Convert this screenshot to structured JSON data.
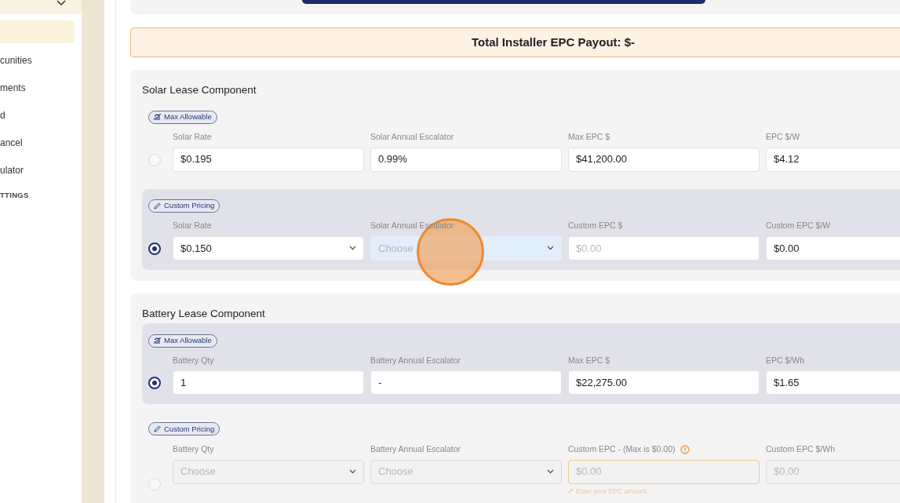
{
  "sidebar": {
    "items": [
      {
        "selected": true
      },
      {
        "label": "cunities",
        "selected": false
      },
      {
        "label": "ments",
        "selected": false
      },
      {
        "label": "d",
        "selected": false
      },
      {
        "label": "ancel",
        "selected": false
      },
      {
        "label": "ulator",
        "selected": false
      }
    ],
    "heading": "TTINGS"
  },
  "payout": {
    "label": "Total Installer EPC Payout: $-"
  },
  "sections": [
    {
      "title": "Solar Lease Component",
      "options": [
        {
          "badge": {
            "kind": "chart",
            "label": "Max Allowable"
          },
          "selected": false,
          "fields": [
            {
              "kind": "input",
              "label": "Solar Rate",
              "value": "$0.195"
            },
            {
              "kind": "input",
              "label": "Solar Annual Escalator",
              "value": "0.99%"
            },
            {
              "kind": "input",
              "label": "Max EPC $",
              "value": "$41,200.00"
            },
            {
              "kind": "input",
              "label": "EPC $/W",
              "value": "$4.12"
            }
          ]
        },
        {
          "badge": {
            "kind": "pencil",
            "label": "Custom Pricing"
          },
          "selected": true,
          "fields": [
            {
              "kind": "select",
              "label": "Solar Rate",
              "value": "$0.150"
            },
            {
              "kind": "select",
              "label": "Solar Annual Escalator",
              "placeholder": "Choose",
              "focused": true
            },
            {
              "kind": "input",
              "label": "Custom EPC $",
              "placeholder": "$0.00"
            },
            {
              "kind": "input",
              "label": "Custom EPC $/W",
              "value": "$0.00"
            }
          ]
        }
      ]
    },
    {
      "title": "Battery Lease Component",
      "options": [
        {
          "badge": {
            "kind": "chart",
            "label": "Max Allowable"
          },
          "selected": true,
          "fields": [
            {
              "kind": "input",
              "label": "Battery Qty",
              "value": "1"
            },
            {
              "kind": "input",
              "label": "Battery Annual Escalator",
              "value": "-"
            },
            {
              "kind": "input",
              "label": "Max EPC $",
              "value": "$22,275.00"
            },
            {
              "kind": "input",
              "label": "EPC $/Wh",
              "value": "$1.65"
            }
          ]
        },
        {
          "badge": {
            "kind": "pencil",
            "label": "Custom Pricing"
          },
          "selected": false,
          "fields": [
            {
              "kind": "select",
              "label": "Battery Qty",
              "placeholder": "Choose",
              "disabled": true
            },
            {
              "kind": "select",
              "label": "Battery Annual Escalator",
              "placeholder": "Choose",
              "disabled": true
            },
            {
              "kind": "input",
              "label": "Custom EPC - (Max is $0.00)",
              "placeholder": "$0.00",
              "disabled": true,
              "warning": true,
              "hint": "Enter your EPC amount."
            },
            {
              "kind": "input",
              "label": "Custom EPC $/Wh",
              "placeholder": "$0.00",
              "disabled": true
            }
          ]
        }
      ]
    }
  ]
}
